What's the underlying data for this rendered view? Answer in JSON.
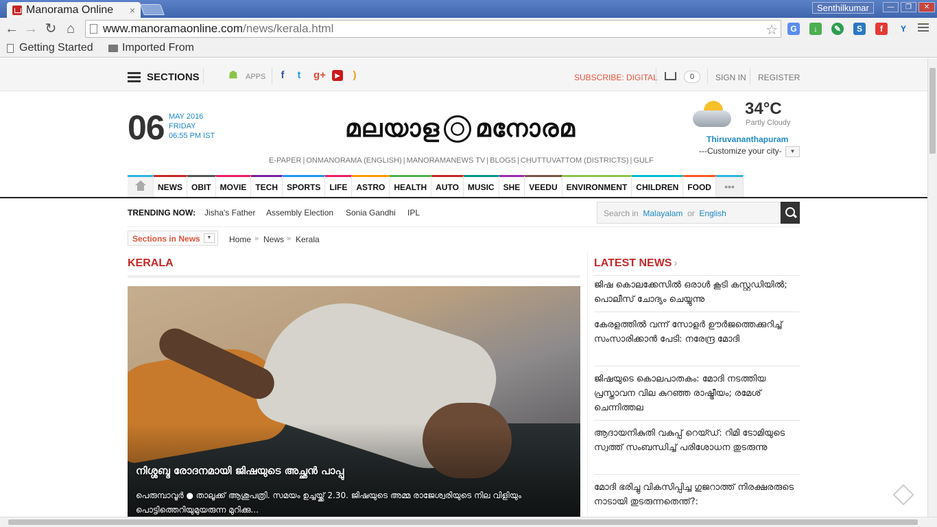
{
  "browser": {
    "tab_title": "Manorama Online",
    "tab_close": "×",
    "user": "Senthilkumar",
    "url_host": "www.manoramaonline.com",
    "url_path": "/news/kerala.html",
    "bookmarks": [
      "Getting Started",
      "Imported From"
    ]
  },
  "topbar": {
    "sections_label": "SECTIONS",
    "apps_label": "APPS",
    "subscribe_label": "SUBSCRIBE: DIGITAL",
    "cart_count": "0",
    "signin_label": "SIGN IN",
    "register_label": "REGISTER"
  },
  "header": {
    "day": "06",
    "month_year": "MAY 2016",
    "weekday": "FRIDAY",
    "time": "06:55 PM IST",
    "logo_text_left": "മലയാള",
    "logo_text_right": "മനോരമ",
    "sublinks": [
      "E-PAPER",
      "ONMANORAMA (ENGLISH)",
      "MANORAMANEWS TV",
      "BLOGS",
      "CHUTTUVATTOM (DISTRICTS)",
      "GULF"
    ],
    "weather": {
      "temp": "34°C",
      "condition": "Partly Cloudy",
      "city": "Thiruvananthapuram",
      "customize": "---Customize your city-"
    }
  },
  "nav": {
    "items": [
      {
        "label": "NEWS",
        "color": "#c62828"
      },
      {
        "label": "OBIT",
        "color": "#555555"
      },
      {
        "label": "MOVIE",
        "color": "#e91e63"
      },
      {
        "label": "TECH",
        "color": "#7b1fa2"
      },
      {
        "label": "SPORTS",
        "color": "#2196f3"
      },
      {
        "label": "LIFE",
        "color": "#e91e63"
      },
      {
        "label": "ASTRO",
        "color": "#ff9800"
      },
      {
        "label": "HEALTH",
        "color": "#4caf50"
      },
      {
        "label": "AUTO",
        "color": "#c62828"
      },
      {
        "label": "MUSIC",
        "color": "#009688"
      },
      {
        "label": "SHE",
        "color": "#9c27b0"
      },
      {
        "label": "VEEDU",
        "color": "#795548"
      },
      {
        "label": "ENVIRONMENT",
        "color": "#8bc34a"
      },
      {
        "label": "CHILDREN",
        "color": "#00bcd4"
      },
      {
        "label": "FOOD",
        "color": "#ff5722"
      }
    ],
    "more_label": "•••"
  },
  "trending": {
    "label": "TRENDING NOW:",
    "items": [
      "Jisha's Father",
      "Assembly Election",
      "Sonia Gandhi",
      "IPL"
    ]
  },
  "search": {
    "prefix": "Search in",
    "lang1": "Malayalam",
    "or": "or",
    "lang2": "English"
  },
  "breadcrumb": {
    "sections_dropdown": "Sections in News",
    "items": [
      "Home",
      "News",
      "Kerala"
    ]
  },
  "main": {
    "section_title": "KERALA",
    "hero_title": "നിശ്ശബ്ദ രോദനമായി ജിഷയുടെ അച്ഛൻ പാപ്പു",
    "hero_desc": "പെരുമ്പാവൂർ ● താലൂക്ക് ആശുപത്രി. സമയം ഉച്ചയ്ക്ക് 2.30. ജിഷയുടെ അമ്മ രാജേശ്വരിയുടെ നില വിളിയും പൊട്ടിത്തെറിയുമുയരുന്ന മുറിക്കു..."
  },
  "latest": {
    "title": "LATEST NEWS",
    "arrow": "›",
    "items": [
      "ജിഷ കൊലക്കേസിൽ ഒരാൾ കൂടി കസ്റ്റഡിയിൽ; പൊലീസ് ചോദ്യം ചെയ്യുന്നു",
      "കേരളത്തിൽ വന്ന് സോളർ ഊർജത്തെക്കുറിച്ച് സംസാരിക്കാൻ പേടി: നരേന്ദ്ര മോദി",
      "ജിഷയുടെ കൊലപാതകം: മോദി നടത്തിയ പ്രസ്താവന വില കുറഞ്ഞ രാഷ്ട്രീയം; രമേശ് ചെന്നിത്തല",
      "ആദായനികുതി വകുപ്പ് റെയ്ഡ്: റിമി ടോമിയുടെ സ്വത്ത് സംബന്ധിച്ച് പരിശോധന തുടരുന്നു",
      "മോദി ഭരിച്ചു വികസിപ്പിച്ച ഗുജറാത്ത് നിരക്ഷരരുടെ നാടായി തുടരുന്നതെന്ത്?:"
    ]
  }
}
